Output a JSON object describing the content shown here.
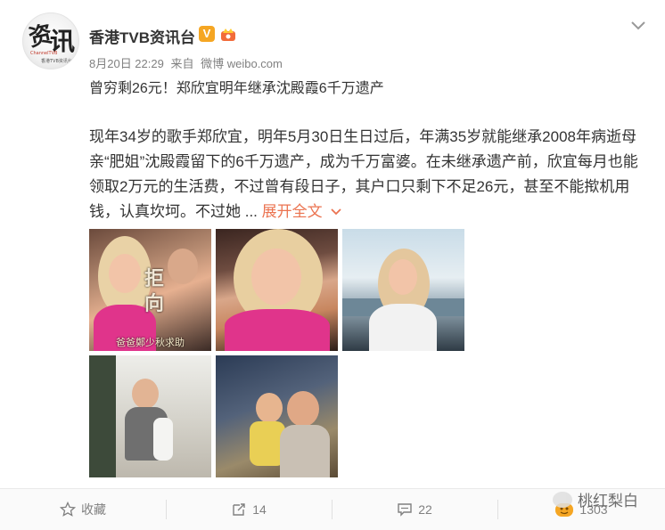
{
  "account": {
    "name": "香港TVB资讯台",
    "verified_badge": "V",
    "logo_chars": [
      "资",
      "讯"
    ],
    "logo_sub": "ChannelTVB",
    "logo_sub2": "香港TVB资讯台"
  },
  "meta": {
    "date": "8月20日 22:29",
    "from_label": "来自",
    "source": "微博 weibo.com"
  },
  "post": {
    "headline": "曾穷剩26元！郑欣宜明年继承沈殿霞6千万遗产",
    "body": "现年34岁的歌手郑欣宜，明年5月30日生日过后，年满35岁就能继承2008年病逝母亲“肥姐”沈殿霞留下的6千万遗产，成为千万富婆。在未继承遗产前，欣宜每月也能领取2万元的生活费，不过曾有段日子，其户口只剩下不足26元，甚至不能揿机用钱，认真坎坷。不过她 ...",
    "expand_label": "展开全文"
  },
  "photos": {
    "photo1_overlay": [
      "拒",
      "向"
    ],
    "photo1_caption": "爸爸鄭少秋求助"
  },
  "footer": {
    "favorite_label": "收藏",
    "repost_count": "14",
    "comment_count": "22",
    "like_count": "1303"
  },
  "watermark": {
    "text": "桃红梨白"
  },
  "colors": {
    "accent": "#eb7350",
    "verified": "#f5a623",
    "text": "#333333",
    "muted": "#808080"
  },
  "icons": [
    "chevron-down-icon",
    "verified-badge-icon",
    "crown-icon",
    "star-icon",
    "repost-icon",
    "comment-icon",
    "like-icon"
  ]
}
